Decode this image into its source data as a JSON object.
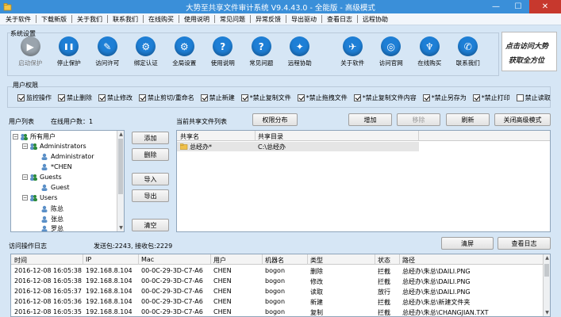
{
  "window": {
    "title": "大势至共享文件审计系统 V9.4.43.0 - 全能版 - 高级模式",
    "minimize_glyph": "—",
    "maximize_glyph": "☐",
    "close_glyph": "✕"
  },
  "menu": [
    "关于软件",
    "下载新版",
    "关于我们",
    "联系我们",
    "在线购买",
    "使用说明",
    "常见问题",
    "异常反馈",
    "导出驱动",
    "查看日志",
    "远程协助"
  ],
  "system_settings": {
    "label": "系统设置",
    "buttons": [
      {
        "label": "启动保护",
        "icon": "play-icon",
        "color": "#9aa4ad",
        "glyph": "▶",
        "disabled": true
      },
      {
        "label": "停止保护",
        "icon": "pause-icon",
        "color": "#1e7fd6",
        "glyph": "❚❚",
        "disabled": false
      },
      {
        "label": "访问许可",
        "icon": "wrench-icon",
        "color": "#1e7fd6",
        "glyph": "✎",
        "disabled": false
      },
      {
        "label": "绑定认证",
        "icon": "gear-icon",
        "color": "#1e7fd6",
        "glyph": "⚙",
        "disabled": false
      },
      {
        "label": "全局设置",
        "icon": "settings-gear-icon",
        "color": "#1e7fd6",
        "glyph": "⚙",
        "disabled": false
      },
      {
        "label": "使用说明",
        "icon": "help-icon",
        "color": "#1e7fd6",
        "glyph": "?",
        "disabled": false
      },
      {
        "label": "常见问题",
        "icon": "question-icon",
        "color": "#1e7fd6",
        "glyph": "?",
        "disabled": false
      },
      {
        "label": "远程协助",
        "icon": "remote-assist-icon",
        "color": "#1e7fd6",
        "glyph": "✦",
        "disabled": false
      },
      {
        "label": "关于软件",
        "icon": "about-icon",
        "color": "#1e7fd6",
        "glyph": "✈",
        "disabled": false
      },
      {
        "label": "访问官网",
        "icon": "globe-icon",
        "color": "#1e7fd6",
        "glyph": "◎",
        "disabled": false
      },
      {
        "label": "在线购买",
        "icon": "cart-icon",
        "color": "#1e7fd6",
        "glyph": "♆",
        "disabled": false
      },
      {
        "label": "联系我们",
        "icon": "contact-icon",
        "color": "#1e7fd6",
        "glyph": "✆",
        "disabled": false
      }
    ]
  },
  "logo_text": [
    "点击访问大势",
    "获取全方位"
  ],
  "permissions": {
    "label": "用户权限",
    "items": [
      {
        "label": "监控操作",
        "checked": true
      },
      {
        "label": "禁止删除",
        "checked": true
      },
      {
        "label": "禁止修改",
        "checked": true
      },
      {
        "label": "禁止剪切/重命名",
        "checked": true
      },
      {
        "label": "禁止新建",
        "checked": true
      },
      {
        "label": "*禁止复制文件",
        "checked": true
      },
      {
        "label": "*禁止拖拽文件",
        "checked": true
      },
      {
        "label": "*禁止复制文件内容",
        "checked": true
      },
      {
        "label": "*禁止另存为",
        "checked": true
      },
      {
        "label": "*禁止打印",
        "checked": true
      },
      {
        "label": "禁止读取",
        "checked": false
      }
    ]
  },
  "users": {
    "label": "用户列表",
    "online_count": "在线用户数：1",
    "tree": [
      {
        "label": "所有用户",
        "level": 0,
        "toggle": "−"
      },
      {
        "label": "Administrators",
        "level": 1,
        "toggle": "−"
      },
      {
        "label": "Administrator",
        "level": 2,
        "toggle": ""
      },
      {
        "label": "*CHEN",
        "level": 2,
        "toggle": ""
      },
      {
        "label": "Guests",
        "level": 1,
        "toggle": "−"
      },
      {
        "label": "Guest",
        "level": 2,
        "toggle": ""
      },
      {
        "label": "Users",
        "level": 1,
        "toggle": "−"
      },
      {
        "label": "陈总",
        "level": 2,
        "toggle": ""
      },
      {
        "label": "张总",
        "level": 2,
        "toggle": ""
      },
      {
        "label": "罗总",
        "level": 2,
        "toggle": ""
      }
    ]
  },
  "side_buttons": {
    "add": "添加",
    "delete": "删除",
    "import": "导入",
    "export": "导出",
    "clear": "清空"
  },
  "share": {
    "label": "当前共享文件列表",
    "perm_button": "权限分布",
    "add_button": "增加",
    "remove_button": "移除",
    "refresh_button": "刷新",
    "advanced_button": "关闭高级模式",
    "columns": [
      "共享名",
      "共享目录"
    ],
    "rows": [
      {
        "name": "总经办*",
        "path": "C:\\总经办"
      }
    ]
  },
  "log": {
    "label": "访问操作日志",
    "stats": "发送包:2243, 接收包:2229",
    "clear_button": "清屏",
    "view_button": "查看日志",
    "columns": [
      "时间",
      "IP",
      "Mac",
      "用户",
      "机器名",
      "类型",
      "状态",
      "路径"
    ],
    "rows": [
      [
        "2016-12-08 16:05:38",
        "192.168.8.104",
        "00-0C-29-3D-C7-A6",
        "CHEN",
        "bogon",
        "删除",
        "拦截",
        "总经办\\朱总\\DAILI.PNG"
      ],
      [
        "2016-12-08 16:05:38",
        "192.168.8.104",
        "00-0C-29-3D-C7-A6",
        "CHEN",
        "bogon",
        "修改",
        "拦截",
        "总经办\\朱总\\DAILI.PNG"
      ],
      [
        "2016-12-08 16:05:37",
        "192.168.8.104",
        "00-0C-29-3D-C7-A6",
        "CHEN",
        "bogon",
        "读取",
        "放行",
        "总经办\\朱总\\DAILI.PNG"
      ],
      [
        "2016-12-08 16:05:36",
        "192.168.8.104",
        "00-0C-29-3D-C7-A6",
        "CHEN",
        "bogon",
        "新建",
        "拦截",
        "总经办\\朱总\\新建文件夹"
      ],
      [
        "2016-12-08 16:05:35",
        "192.168.8.104",
        "00-0C-29-3D-C7-A6",
        "CHEN",
        "bogon",
        "复制",
        "拦截",
        "总经办\\朱总\\CHANGJIAN.TXT"
      ]
    ]
  }
}
